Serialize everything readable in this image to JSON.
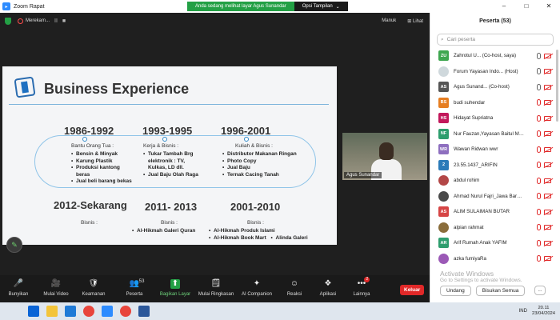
{
  "window": {
    "title": "Zoom Rapat",
    "controls": [
      "–",
      "□",
      "✕"
    ]
  },
  "banner": {
    "text": "Anda sedang melihat layar Agus Sunandar",
    "option": "Opsi Tampilan",
    "option_caret": "⌄"
  },
  "meetbar": {
    "recording": "Merekam...",
    "pause": "II",
    "stop": "■",
    "view_layout": "Manuk",
    "view": "Lihat"
  },
  "slide": {
    "title": "Business Experience",
    "blocks": [
      {
        "year": "1986-1992",
        "heading": "Bantu Orang Tua :",
        "items": [
          "Bensin & Minyak",
          "Karung Plastik",
          "Produksi kantong beras",
          "Jual beli barang bekas"
        ]
      },
      {
        "year": "1993-1995",
        "heading": "Kerja & Bisnis :",
        "items": [
          "Tukar Tambah Brg elektronik : TV, Kulkas, LD dll.",
          "Jual Baju Olah Raga"
        ]
      },
      {
        "year": "1996-2001",
        "heading": "Kuliah & Bisnis :",
        "items": [
          "Distributor Makanan Ringan",
          "Photo Copy",
          "Jual Baju",
          "Ternak Cacing Tanah"
        ]
      },
      {
        "year": "2012-Sekarang",
        "heading": "Bisnis :",
        "items": []
      },
      {
        "year": "2011- 2013",
        "heading": "Bisnis :",
        "items": [
          "Al-Hikmah Galeri Quran"
        ]
      },
      {
        "year": "2001-2010",
        "heading": "Bisnis :",
        "items": [
          "Al-Hikmah Produk Islami",
          "Al-Hikmah Book Mart",
          "Alinda Galeri"
        ]
      }
    ]
  },
  "video": {
    "name": "Agus Sunandar"
  },
  "toolbar": {
    "items": [
      {
        "label": "Bunyikan",
        "icon": "🎤"
      },
      {
        "label": "Mulai Video",
        "icon": "🎥"
      },
      {
        "label": "Keamanan",
        "icon": "🛡"
      },
      {
        "label": "Peserta",
        "icon": "👥",
        "count": "53"
      },
      {
        "label": "Bagikan Layar",
        "icon": "⬆"
      },
      {
        "label": "Mulai Ringkasan",
        "icon": "🗒"
      },
      {
        "label": "AI Companion",
        "icon": "✦"
      },
      {
        "label": "Reaksi",
        "icon": "☺"
      },
      {
        "label": "Aplikasi",
        "icon": "❖"
      },
      {
        "label": "Lainnya",
        "icon": "•••",
        "badge": "2"
      }
    ],
    "exit": "Keluar"
  },
  "panel": {
    "title": "Peserta (53)",
    "search_placeholder": "Cari peserta",
    "participants": [
      {
        "initials": "ZU",
        "color": "#3fa750",
        "name": "Zahrotul U... (Co-host, saya)"
      },
      {
        "initials": "",
        "color": "#cfd8dc",
        "name": "Forum Yayasan Indo... (Host)"
      },
      {
        "initials": "AS",
        "color": "#555555",
        "name": "Agus Sunand... (Co-host)"
      },
      {
        "initials": "BS",
        "color": "#e67e22",
        "name": "budi suhendar"
      },
      {
        "initials": "HS",
        "color": "#c2185b",
        "name": "Hidayat Supriatna"
      },
      {
        "initials": "NF",
        "color": "#2e9e6e",
        "name": "Nur Fauzan,Yayasan Baitul Musl..."
      },
      {
        "initials": "WR",
        "color": "#8e6fbf",
        "name": "Wawan Ridwan wwr"
      },
      {
        "initials": "2",
        "color": "#2b7bb9",
        "name": "23.55.1437_ARIFIN"
      },
      {
        "initials": "",
        "color": "#b34747",
        "name": "abdul rohim"
      },
      {
        "initials": "",
        "color": "#4a4a4a",
        "name": "Ahmad Nurul Fajri_Jawa Barat ..."
      },
      {
        "initials": "AS",
        "color": "#d64545",
        "name": "ALIM SULAIMAN BUTAR"
      },
      {
        "initials": "",
        "color": "#8a6d3b",
        "name": "alpian rahmat"
      },
      {
        "initials": "AR",
        "color": "#2e9e6e",
        "name": "Arif Rumah Anak YAFIM"
      },
      {
        "initials": "",
        "color": "#9b59b6",
        "name": "azka fumiyaRa"
      }
    ],
    "watermark_title": "Activate Windows",
    "watermark_sub": "Go to Settings to activate Windows.",
    "invite": "Undang",
    "mute_all": "Bisukan Semua",
    "more": "..."
  },
  "taskbar": {
    "lang": "IND",
    "time": "20.11",
    "date": "23/04/2024"
  }
}
